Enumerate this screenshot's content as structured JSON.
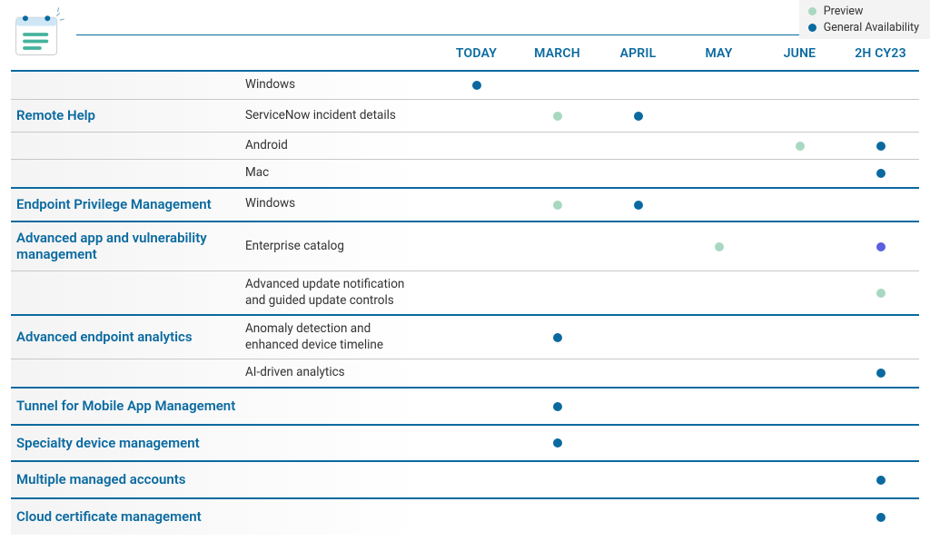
{
  "legend": {
    "preview": "Preview",
    "ga": "General Availability"
  },
  "columns": [
    "TODAY",
    "MARCH",
    "APRIL",
    "MAY",
    "JUNE",
    "2H CY23"
  ],
  "sections": [
    {
      "name": "Remote Help",
      "items": [
        {
          "label": "Windows",
          "dots": {
            "TODAY": "ga"
          }
        },
        {
          "label": "ServiceNow incident details",
          "dots": {
            "MARCH": "preview",
            "APRIL": "ga"
          }
        },
        {
          "label": "Android",
          "dots": {
            "JUNE": "preview",
            "2H CY23": "ga"
          }
        },
        {
          "label": "Mac",
          "dots": {
            "2H CY23": "ga"
          }
        }
      ]
    },
    {
      "name": "Endpoint Privilege Management",
      "items": [
        {
          "label": "Windows",
          "dots": {
            "MARCH": "preview",
            "APRIL": "ga"
          }
        }
      ]
    },
    {
      "name": "Advanced app and vulnerability management",
      "items": [
        {
          "label": "Enterprise catalog",
          "dots": {
            "MAY": "preview",
            "2H CY23": "purple"
          }
        },
        {
          "label": "Advanced update notification and guided update controls",
          "dots": {
            "2H CY23": "preview"
          }
        }
      ]
    },
    {
      "name": "Advanced endpoint analytics",
      "items": [
        {
          "label": "Anomaly detection and enhanced device timeline",
          "dots": {
            "MARCH": "ga"
          }
        },
        {
          "label": "AI-driven analytics",
          "dots": {
            "2H CY23": "ga"
          }
        }
      ]
    }
  ],
  "singles": [
    {
      "name": "Tunnel for Mobile App Management",
      "dots": {
        "MARCH": "ga"
      }
    },
    {
      "name": "Specialty device management",
      "dots": {
        "MARCH": "ga"
      }
    },
    {
      "name": "Multiple managed accounts",
      "dots": {
        "2H CY23": "ga"
      }
    },
    {
      "name": "Cloud certificate management",
      "dots": {
        "2H CY23": "ga"
      }
    }
  ],
  "chart_data": {
    "type": "table",
    "title": "Feature roadmap timeline",
    "columns": [
      "TODAY",
      "MARCH",
      "APRIL",
      "MAY",
      "JUNE",
      "2H CY23"
    ],
    "legend": {
      "preview": "Preview",
      "ga": "General Availability"
    },
    "rows": [
      {
        "feature": "Remote Help",
        "item": "Windows",
        "marks": {
          "TODAY": "General Availability"
        }
      },
      {
        "feature": "Remote Help",
        "item": "ServiceNow incident details",
        "marks": {
          "MARCH": "Preview",
          "APRIL": "General Availability"
        }
      },
      {
        "feature": "Remote Help",
        "item": "Android",
        "marks": {
          "JUNE": "Preview",
          "2H CY23": "General Availability"
        }
      },
      {
        "feature": "Remote Help",
        "item": "Mac",
        "marks": {
          "2H CY23": "General Availability"
        }
      },
      {
        "feature": "Endpoint Privilege Management",
        "item": "Windows",
        "marks": {
          "MARCH": "Preview",
          "APRIL": "General Availability"
        }
      },
      {
        "feature": "Advanced app and vulnerability management",
        "item": "Enterprise catalog",
        "marks": {
          "MAY": "Preview",
          "2H CY23": "General Availability"
        }
      },
      {
        "feature": "Advanced app and vulnerability management",
        "item": "Advanced update notification and guided update controls",
        "marks": {
          "2H CY23": "Preview"
        }
      },
      {
        "feature": "Advanced endpoint analytics",
        "item": "Anomaly detection and enhanced device timeline",
        "marks": {
          "MARCH": "General Availability"
        }
      },
      {
        "feature": "Advanced endpoint analytics",
        "item": "AI-driven analytics",
        "marks": {
          "2H CY23": "General Availability"
        }
      },
      {
        "feature": "Tunnel for Mobile App Management",
        "item": "",
        "marks": {
          "MARCH": "General Availability"
        }
      },
      {
        "feature": "Specialty device management",
        "item": "",
        "marks": {
          "MARCH": "General Availability"
        }
      },
      {
        "feature": "Multiple managed accounts",
        "item": "",
        "marks": {
          "2H CY23": "General Availability"
        }
      },
      {
        "feature": "Cloud certificate management",
        "item": "",
        "marks": {
          "2H CY23": "General Availability"
        }
      }
    ]
  }
}
